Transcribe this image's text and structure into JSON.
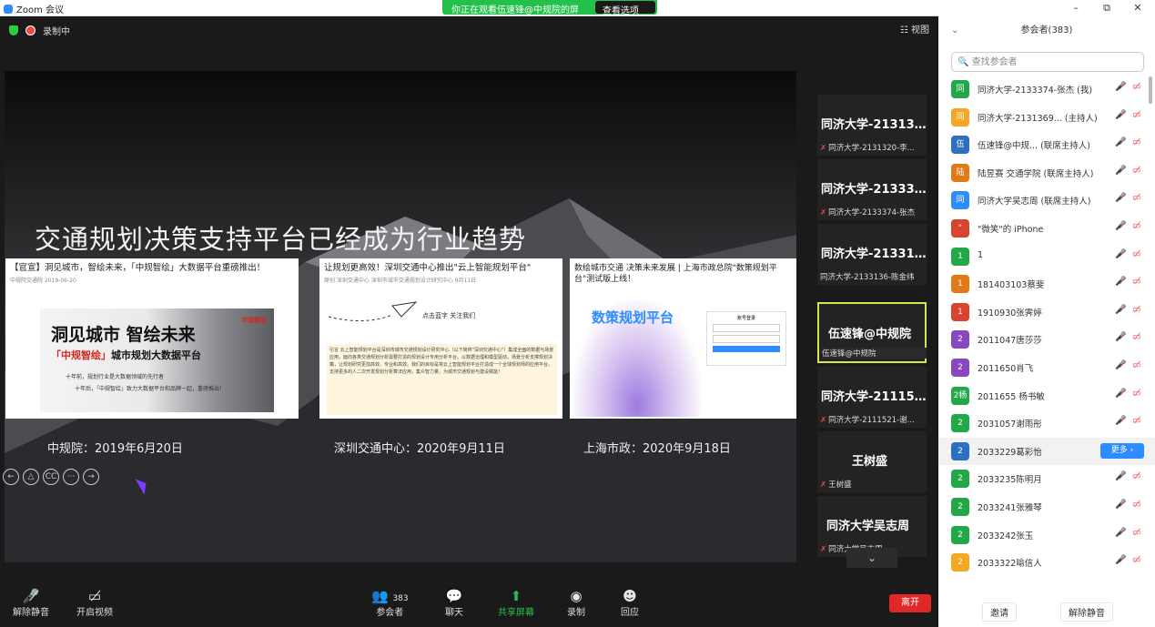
{
  "window": {
    "title": "Zoom 会议",
    "minimize": "–",
    "restore": "⧉",
    "close": "✕"
  },
  "share_banner": {
    "text": "你正在观看伍速锋@中规院的屏幕",
    "options": "查看选项 ⌄"
  },
  "stage": {
    "recording": "录制中",
    "view_btn": "☷ 视图"
  },
  "slide": {
    "title": "交通规划决策支持平台已经成为行业趋势",
    "panel1": {
      "head": "【官宣】洞见城市，智绘未来，「中规智绘」大数据平台重磅推出！",
      "sub": "中规院交通院   2019-06-20",
      "banner_title": "洞见城市 智绘未来",
      "banner_sub_red": "「中规智绘」",
      "banner_sub": "城市规划大数据平台",
      "banner_line1": "十年前，规划行业是大数据领域的先行者",
      "banner_line2": "十年后，「中规智绘」致力大数据平台和品牌一起，重磅推出！",
      "logo": "中规智绘"
    },
    "panel2": {
      "head": "让规划更高效！深圳交通中心推出\"云上智能规划平台\"",
      "sub": "原创  深圳交通中心  深圳市城市交通规划设计研究中心  9月11日",
      "follow": "点击蓝字 关注我们",
      "body": "引言  云上智能规划平台是深圳市城市交通规划设计研究中心（以下简称\"深圳交通中心\"）集成全面的数据与场景应用，面向各类交通规划分析需要打造的规划设计专用分析平台。以数据治理和模型驱动，场景分析支撑规划决策，让规划研究更加高效、专业和高效。我们的目标是将云上智能规划平台打造成一个全球规划师的应用平台，支持更多的人二次开发规划分析算法应用，集众智力量，为城市交通规划与建设赋能！"
    },
    "panel3": {
      "head": "数绘城市交通 决策未来发展 | 上海市政总院\"数策规划平台\"测试版上线！",
      "vis_title": "数策规划平台",
      "login_title": "账号登录"
    },
    "captions": [
      "中规院：2019年6月20日",
      "深圳交通中心：2020年9月11日",
      "上海市政：2020年9月18日"
    ],
    "controls": [
      "←",
      "△",
      "CC",
      "···",
      "→"
    ]
  },
  "strip": [
    {
      "name": "同济大学-2131320-李...",
      "sub": "同济大学-2131320-李...",
      "muted": true
    },
    {
      "name": "同济大学-2133374-张杰",
      "sub": "同济大学-2133374-张杰",
      "muted": true
    },
    {
      "name": "同济大学-2133136-陈金纬",
      "sub": "同济大学-2133136-陈金纬",
      "muted": false
    },
    {
      "name": "伍速锋@中规院",
      "sub": "伍速锋@中规院",
      "muted": false
    },
    {
      "name": "同济大学-2111521-谢...",
      "sub": "同济大学-2111521-谢...",
      "muted": true
    },
    {
      "name": "王树盛",
      "sub": "王树盛",
      "muted": true
    },
    {
      "name": "同济大学吴志周",
      "sub": "同济大学吴志周",
      "muted": true
    }
  ],
  "strip_down": "⌄",
  "toolbar": {
    "unmute": "解除静音",
    "video": "开启视频",
    "participants": "参会者",
    "participants_count": "383",
    "chat": "聊天",
    "share": "共享屏幕",
    "record": "录制",
    "reactions": "回应",
    "leave": "离开"
  },
  "side": {
    "title": "参会者(383)",
    "search_placeholder": "查找参会者",
    "invite": "邀请",
    "unmute_all": "解除静音",
    "more": "更多 ›",
    "participants": [
      {
        "avatar": "同",
        "color": "#23a847",
        "name": "同济大学-2133374-张杰 (我)"
      },
      {
        "avatar": "同",
        "color": "#f5a623",
        "name": "同济大学-2131369... (主持人)"
      },
      {
        "avatar": "伍",
        "color": "#2d6fc2",
        "name": "伍速锋@中规... (联席主持人)"
      },
      {
        "avatar": "陆",
        "color": "#e07a16",
        "name": "陆昱赛 交通学院 (联席主持人)"
      },
      {
        "avatar": "同",
        "color": "#2d8cff",
        "name": "同济大学吴志周 (联席主持人)"
      },
      {
        "avatar": "\"",
        "color": "#d94430",
        "name": "\"微笑\"的 iPhone"
      },
      {
        "avatar": "1",
        "color": "#23a847",
        "name": "1"
      },
      {
        "avatar": "1",
        "color": "#e07a16",
        "name": "181403103蔡斐"
      },
      {
        "avatar": "1",
        "color": "#d94430",
        "name": "1910930张霁婷"
      },
      {
        "avatar": "2",
        "color": "#8a47c2",
        "name": "2011047唐莎莎"
      },
      {
        "avatar": "2",
        "color": "#8a47c2",
        "name": "2011650肖飞"
      },
      {
        "avatar": "2杨",
        "color": "#23a847",
        "name": "2011655 杨书敏"
      },
      {
        "avatar": "2",
        "color": "#23a847",
        "name": "2031057谢雨彤"
      },
      {
        "avatar": "2",
        "color": "#2d6fc2",
        "name": "2033229葛彩怡"
      },
      {
        "avatar": "2",
        "color": "#23a847",
        "name": "2033235陈明月"
      },
      {
        "avatar": "2",
        "color": "#23a847",
        "name": "2033241张雅琴"
      },
      {
        "avatar": "2",
        "color": "#23a847",
        "name": "2033242张玉"
      },
      {
        "avatar": "2",
        "color": "#f5a623",
        "name": "2033322喻信人"
      }
    ]
  }
}
